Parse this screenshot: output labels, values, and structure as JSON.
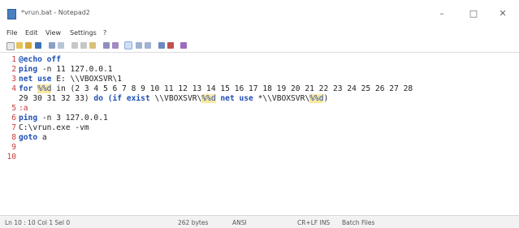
{
  "window": {
    "title": "*vrun.bat - Notepad2",
    "minimize_glyph": "–",
    "maximize_glyph": "□",
    "close_glyph": "✕"
  },
  "menu": [
    "File",
    "Edit",
    "View",
    "Settings",
    "?"
  ],
  "toolbar_icons": [
    "new-icon",
    "open-icon",
    "browse-icon",
    "save-icon",
    "undo-icon",
    "redo-icon",
    "cut-icon",
    "copy-icon",
    "paste-icon",
    "find-icon",
    "replace-icon",
    "word-wrap-icon",
    "zoom-in-icon",
    "zoom-out-icon",
    "scheme-icon",
    "customize-icon",
    "exit-icon"
  ],
  "editor": {
    "lines": [
      {
        "n": "1",
        "parts": [
          {
            "t": "@echo off",
            "c": "kw"
          }
        ]
      },
      {
        "n": "2",
        "parts": [
          {
            "t": "ping",
            "c": "kw"
          },
          {
            "t": " -n 11 127.0.0.1",
            "c": ""
          }
        ]
      },
      {
        "n": "3",
        "parts": [
          {
            "t": "net use",
            "c": "kw"
          },
          {
            "t": " E: \\\\VBOXSVR\\1",
            "c": ""
          }
        ]
      },
      {
        "n": "4",
        "parts": [
          {
            "t": "for",
            "c": "kw"
          },
          {
            "t": " ",
            "c": ""
          },
          {
            "t": "%%d",
            "c": "var"
          },
          {
            "t": " in (2 3 4 5 6 7 8 9 10 11 12 13 14 15 16 17 18 19 20 21 22 23 24 25 26 27 28",
            "c": ""
          }
        ]
      },
      {
        "n": "",
        "parts": [
          {
            "t": "29 30 31 32 33) ",
            "c": ""
          },
          {
            "t": "do (if exist",
            "c": "kw"
          },
          {
            "t": " \\\\VBOXSVR\\",
            "c": ""
          },
          {
            "t": "%%d",
            "c": "var"
          },
          {
            "t": " ",
            "c": ""
          },
          {
            "t": "net use",
            "c": "kw"
          },
          {
            "t": " *\\\\VBOXSVR\\",
            "c": ""
          },
          {
            "t": "%%d",
            "c": "var"
          },
          {
            "t": ")",
            "c": ""
          }
        ]
      },
      {
        "n": "5",
        "parts": [
          {
            "t": ":a",
            "c": "label"
          }
        ]
      },
      {
        "n": "6",
        "parts": [
          {
            "t": "ping",
            "c": "kw"
          },
          {
            "t": " -n 3 127.0.0.1",
            "c": ""
          }
        ]
      },
      {
        "n": "7",
        "parts": [
          {
            "t": "C:\\vrun.exe -vm",
            "c": ""
          }
        ]
      },
      {
        "n": "8",
        "parts": [
          {
            "t": "goto",
            "c": "kw"
          },
          {
            "t": " a",
            "c": ""
          }
        ]
      },
      {
        "n": "9",
        "parts": []
      },
      {
        "n": "10",
        "parts": []
      }
    ]
  },
  "status": {
    "position": "Ln 10 : 10   Col 1   Sel 0",
    "size": "262 bytes",
    "encoding": "ANSI",
    "line_endings": "CR+LF  INS",
    "scheme": "Batch Files"
  }
}
